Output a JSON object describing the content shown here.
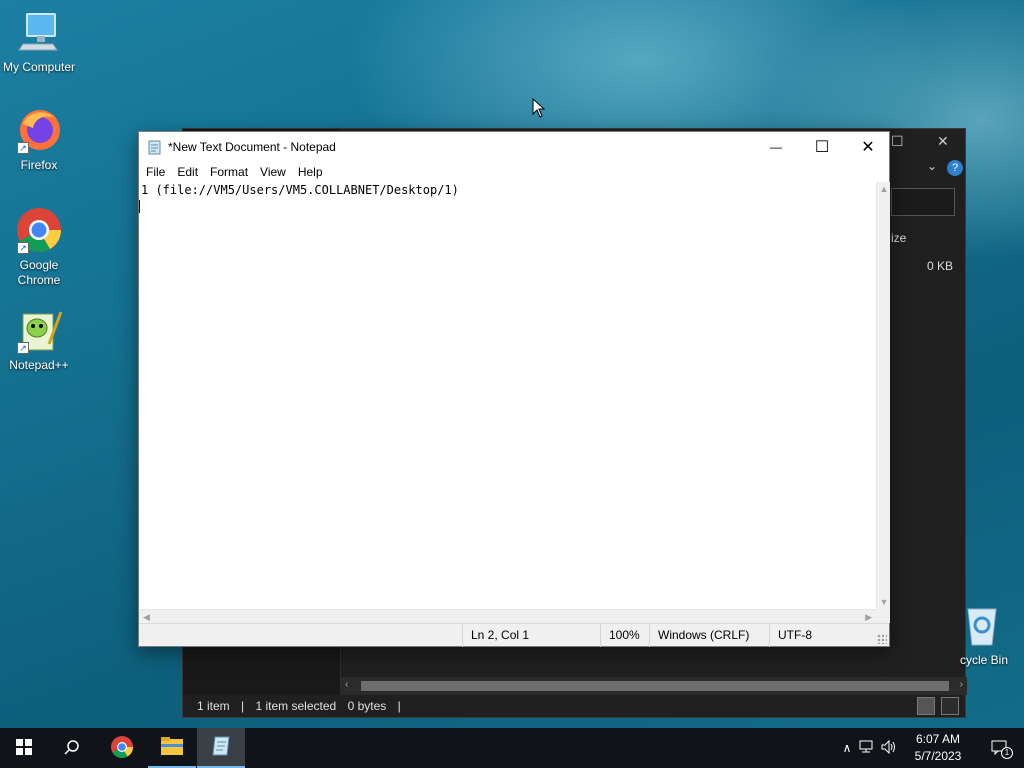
{
  "desktop": {
    "icons": [
      {
        "label": "My Computer"
      },
      {
        "label": "Firefox"
      },
      {
        "label": "Google Chrome"
      },
      {
        "label": "Notepad++"
      }
    ],
    "recycle_bin_label": "cycle Bin"
  },
  "explorer": {
    "column_header_partial": "ize",
    "file_size": "0 KB",
    "status": {
      "item_count": "1 item",
      "selected": "1 item selected",
      "size": "0 bytes"
    },
    "title_buttons": {
      "close": "✕",
      "restore": "☐"
    }
  },
  "notepad": {
    "title": "*New Text Document - Notepad",
    "menu": [
      "File",
      "Edit",
      "Format",
      "View",
      "Help"
    ],
    "content": "1 (file://VM5/Users/VM5.COLLABNET/Desktop/1)",
    "status": {
      "position": "Ln 2, Col 1",
      "zoom": "100%",
      "line_ending": "Windows (CRLF)",
      "encoding": "UTF-8"
    },
    "controls": {
      "minimize": "—",
      "maximize": "☐",
      "close": "✕"
    }
  },
  "taskbar": {
    "time": "6:07 AM",
    "date": "5/7/2023",
    "notification_count": "1",
    "pinned": [
      "start-icon",
      "search-icon",
      "chrome-icon",
      "file-explorer-icon",
      "notepad-icon"
    ]
  },
  "colors": {
    "accent": "#76b9ed",
    "taskbar": "#101418",
    "explorer_dark": "#202020"
  }
}
